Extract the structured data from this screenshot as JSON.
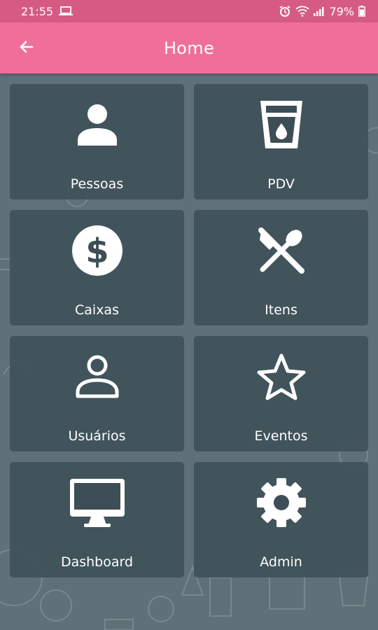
{
  "status_bar": {
    "time": "21:55",
    "battery": "79%"
  },
  "app_bar": {
    "title": "Home",
    "back_icon": "arrow-left-icon"
  },
  "colors": {
    "status_bar": "#d65b84",
    "app_bar": "#ef6f9a",
    "background": "#5f7078",
    "tile": "#3e4e56"
  },
  "menu": [
    {
      "label": "Pessoas",
      "icon": "person-icon"
    },
    {
      "label": "PDV",
      "icon": "cup-icon"
    },
    {
      "label": "Caixas",
      "icon": "dollar-coin-icon"
    },
    {
      "label": "Itens",
      "icon": "cutlery-icon"
    },
    {
      "label": "Usuários",
      "icon": "user-outline-icon"
    },
    {
      "label": "Eventos",
      "icon": "star-outline-icon"
    },
    {
      "label": "Dashboard",
      "icon": "monitor-icon"
    },
    {
      "label": "Admin",
      "icon": "gear-icon"
    }
  ]
}
